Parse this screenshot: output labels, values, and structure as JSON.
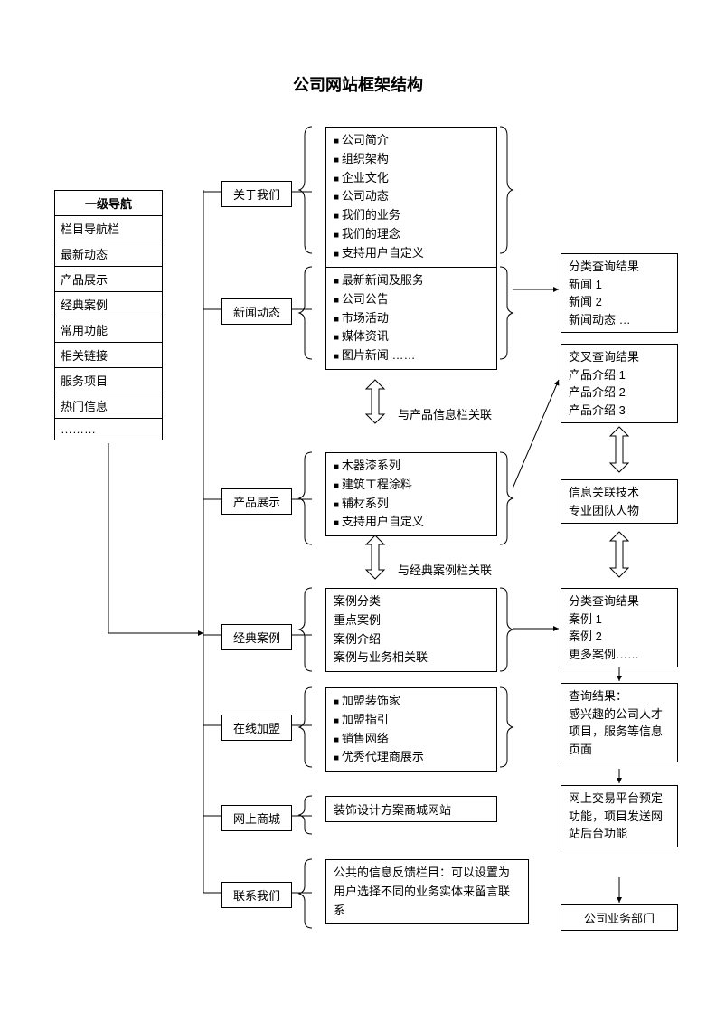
{
  "title": "公司网站框架结构",
  "nav": {
    "header": "一级导航",
    "items": [
      "栏目导航栏",
      "最新动态",
      "产品展示",
      "经典案例",
      "常用功能",
      "相关链接",
      "服务项目",
      "热门信息",
      "………"
    ]
  },
  "sections": {
    "about": {
      "label": "关于我们",
      "items": [
        "公司简介",
        "组织架构",
        "企业文化",
        "公司动态",
        "我们的业务",
        "我们的理念",
        "支持用户自定义"
      ]
    },
    "news": {
      "label": "新闻动态",
      "items": [
        "最新新闻及服务",
        "公司公告",
        "市场活动",
        "媒体资讯",
        "图片新闻   ……"
      ]
    },
    "product": {
      "label": "产品展示",
      "items": [
        "木器漆系列",
        "建筑工程涂料",
        "辅材系列",
        "支持用户自定义"
      ]
    },
    "cases": {
      "label": "经典案例",
      "items": [
        "案例分类",
        "重点案例",
        "案例介绍",
        "案例与业务相关联"
      ]
    },
    "join": {
      "label": "在线加盟",
      "items": [
        "加盟装饰家",
        "加盟指引",
        "销售网络",
        "优秀代理商展示"
      ]
    },
    "shop": {
      "label": "网上商城",
      "text": "装饰设计方案商城网站"
    },
    "contact": {
      "label": "联系我们",
      "text": "公共的信息反馈栏目：可以设置为用户选择不同的业务实体来留言联系"
    }
  },
  "notes": {
    "link_product": "与产品信息栏关联",
    "link_cases": "与经典案例栏关联"
  },
  "right": {
    "r1": "分类查询结果\n新闻 1\n新闻 2\n新闻动态 …",
    "r2": "交叉查询结果\n产品介绍 1\n产品介绍 2\n产品介绍 3",
    "r3": "信息关联技术\n专业团队人物",
    "r4": "分类查询结果\n案例 1\n案例 2\n更多案例……",
    "r5": "查询结果：\n感兴趣的公司人才项目，服务等信息页面",
    "r6": "网上交易平台预定功能，项目发送网站后台功能",
    "r7": "公司业务部门"
  }
}
